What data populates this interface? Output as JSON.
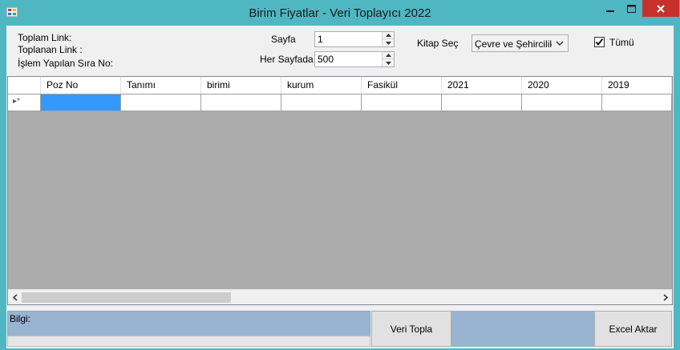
{
  "window": {
    "title": "Birim Fiyatlar - Veri Toplayıcı 2022",
    "minimize_glyph": "—",
    "maximize_glyph": "☐",
    "close_glyph": "✕"
  },
  "stats": {
    "toplam_link": "Toplam Link:",
    "toplanan_link": "Toplanan Link :",
    "islem_sira": "İşlem Yapılan Sıra No:"
  },
  "sayfa": {
    "label": "Sayfa",
    "value": "1"
  },
  "her_sayfada": {
    "label": "Her Sayfada",
    "value": "500"
  },
  "kitap": {
    "label": "Kitap Seç",
    "selected": "Çevre ve Şehircilik B"
  },
  "tumu": {
    "label": "Tümü",
    "checked": true
  },
  "grid": {
    "columns": [
      "Poz No",
      "Tanımı",
      "birimi",
      "kurum",
      "Fasikül",
      "2021",
      "2020",
      "2019"
    ],
    "new_row_marker": "▸*"
  },
  "bilgi": {
    "label": "Bilgi:"
  },
  "buttons": {
    "veri_topla": "Veri Topla",
    "excel_aktar": "Excel Aktar"
  },
  "colors": {
    "titlebar": "#4fb7c2",
    "close": "#c7312b",
    "selection": "#3399ff",
    "info_panel": "#99b4d1",
    "grid_background": "#ababab"
  }
}
